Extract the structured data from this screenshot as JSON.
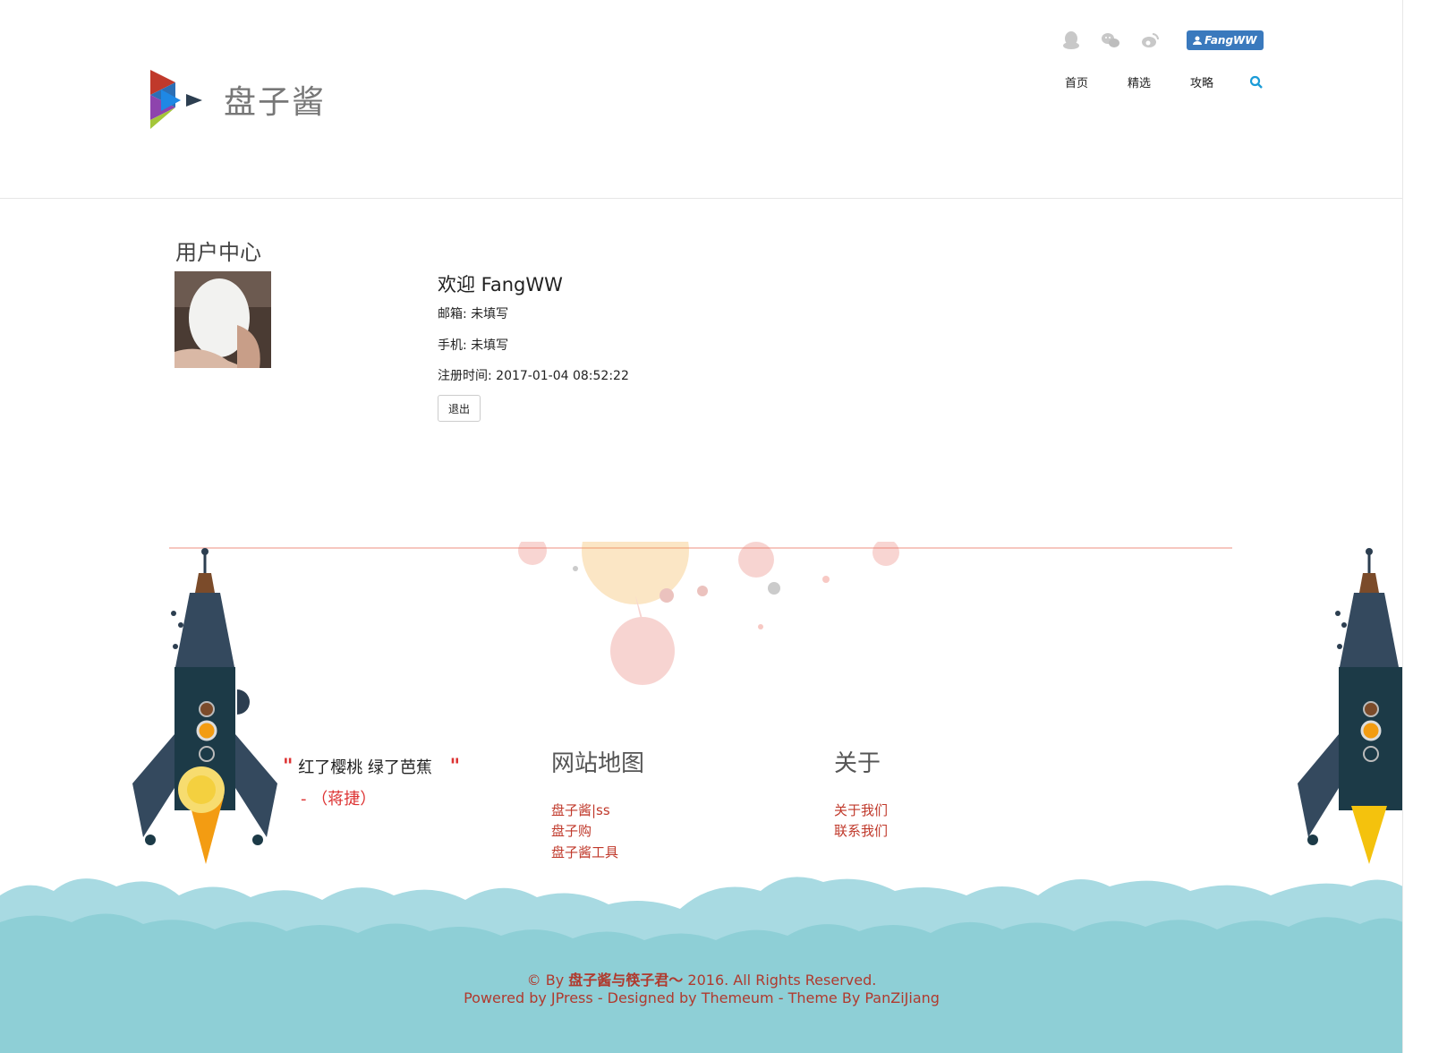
{
  "header": {
    "site_name": "盘子酱",
    "user_button": "FangWW",
    "nav": [
      "首页",
      "精选",
      "攻略"
    ],
    "icons": [
      "qq-icon",
      "wechat-icon",
      "weibo-icon",
      "user-icon",
      "search-icon"
    ]
  },
  "main": {
    "title": "用户中心",
    "welcome": "欢迎 FangWW",
    "email": "邮箱: 未填写",
    "phone": "手机: 未填写",
    "registered": "注册时间: 2017-01-04 08:52:22",
    "logout": "退出"
  },
  "footer": {
    "quote_text": "红了樱桃 绿了芭蕉",
    "quote_open": "\"",
    "quote_close": "\"",
    "quote_author": "- （蒋捷）",
    "sitemap_title": "网站地图",
    "sitemap_links": [
      "盘子酱|ss",
      "盘子购",
      "盘子酱工具"
    ],
    "about_title": "关于",
    "about_links": [
      "关于我们",
      "联系我们"
    ],
    "copyright_prefix": "© By ",
    "copyright_name": "盘子酱与筷子君～",
    "copyright_suffix": " 2016. All Rights Reserved.",
    "powered": "Powered by JPress - Designed by Themeum - Theme By PanZiJiang"
  },
  "colors": {
    "accent": "#3a79bd",
    "link_red": "#c0392b",
    "cloud": "#8ecfd6"
  }
}
